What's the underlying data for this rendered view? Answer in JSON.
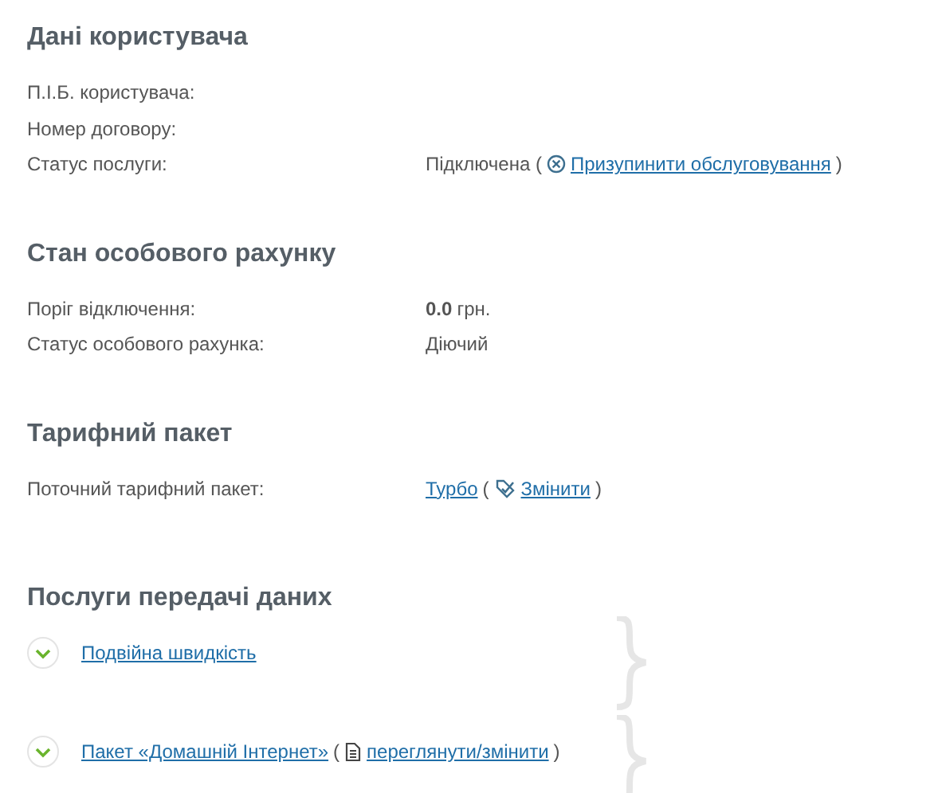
{
  "sections": [
    {
      "kind": "details",
      "title": "Дані користувача",
      "rows": [
        {
          "label": "П.І.Б. користувача:",
          "value": []
        },
        {
          "label": "Номер договору:",
          "value": []
        },
        {
          "label": "Статус послуги:",
          "value": [
            {
              "kind": "text",
              "text": "Підключена ("
            },
            {
              "kind": "cancel-icon"
            },
            {
              "kind": "link",
              "text": "Призупинити обслуговування"
            },
            {
              "kind": "text",
              "text": ")"
            }
          ]
        }
      ]
    },
    {
      "kind": "details",
      "title": "Стан особового рахунку",
      "rows": [
        {
          "label": "Поріг відключення:",
          "value": [
            {
              "kind": "strong",
              "text": "0.0"
            },
            {
              "kind": "text",
              "text": "грн."
            }
          ]
        },
        {
          "label": "Статус особового рахунка:",
          "value": [
            {
              "kind": "text",
              "text": "Діючий"
            }
          ]
        }
      ]
    },
    {
      "kind": "details",
      "title": "Тарифний пакет",
      "rows": [
        {
          "label": "Поточний тарифний пакет:",
          "value": [
            {
              "kind": "link",
              "text": "Турбо"
            },
            {
              "kind": "text",
              "text": "("
            },
            {
              "kind": "edit-icon"
            },
            {
              "kind": "link",
              "text": "Змінити"
            },
            {
              "kind": "text",
              "text": ")"
            }
          ]
        }
      ]
    },
    {
      "kind": "services",
      "title": "Послуги передачі даних",
      "items": [
        {
          "expanded": false,
          "value": [
            {
              "kind": "link",
              "text": "Подвійна швидкість"
            }
          ]
        },
        {
          "expanded": false,
          "value": [
            {
              "kind": "link",
              "text": "Пакет «Домашній Інтернет»"
            },
            {
              "kind": "text",
              "text": "("
            },
            {
              "kind": "doc-icon"
            },
            {
              "kind": "link",
              "text": "переглянути/змінити"
            },
            {
              "kind": "text",
              "text": ")"
            }
          ]
        }
      ]
    }
  ]
}
